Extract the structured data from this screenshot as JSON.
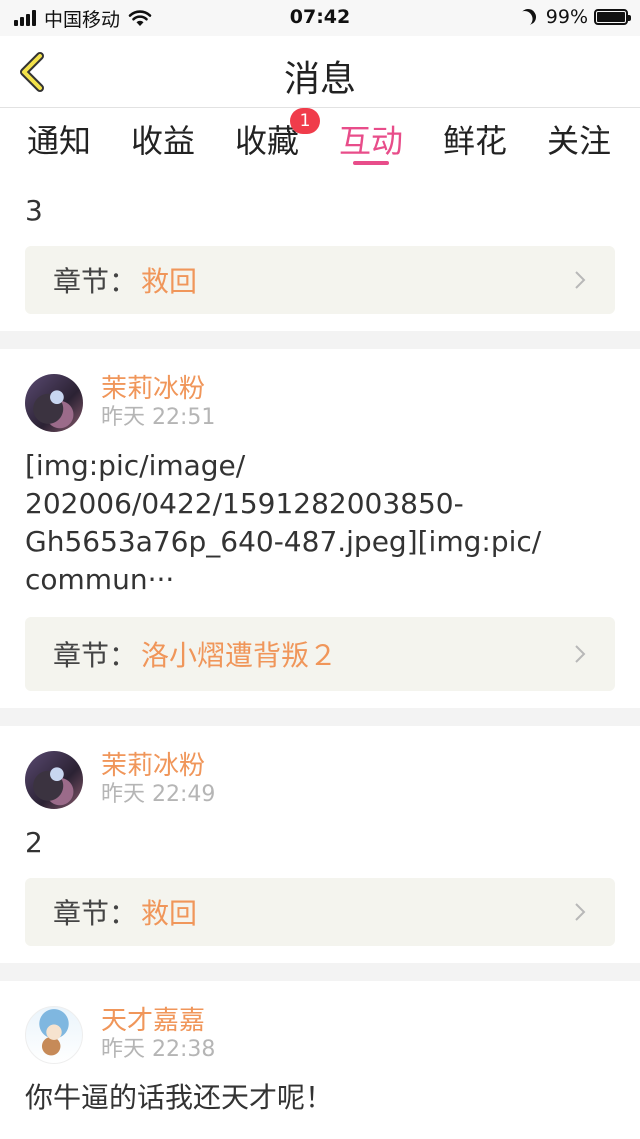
{
  "status_bar": {
    "carrier": "中国移动",
    "time": "07:42",
    "battery": "99%",
    "battery_level": 0.99,
    "icons": [
      "signal-icon",
      "wifi-icon",
      "moon-icon",
      "battery-icon"
    ]
  },
  "nav": {
    "title": "消息",
    "back_icon": "chevron-left-icon"
  },
  "tabs": [
    {
      "label": "通知",
      "active": false
    },
    {
      "label": "收益",
      "active": false
    },
    {
      "label": "收藏",
      "active": false,
      "badge": "1"
    },
    {
      "label": "互动",
      "active": true
    },
    {
      "label": "鲜花",
      "active": false
    },
    {
      "label": "关注",
      "active": false
    }
  ],
  "colors": {
    "accent": "#e84d8a",
    "name": "#f0965a",
    "badge": "#f03c4b",
    "chapter_bg": "#f4f4ee"
  },
  "feed": [
    {
      "text": "3",
      "chapter_prefix": "章节：",
      "chapter": "救回"
    },
    {
      "author": "茉莉冰粉",
      "time": "昨天 22:51",
      "text_lines": [
        "[img:pic/image/",
        "202006/0422/1591282003850-",
        "Gh5653a76p_640-487.jpeg][img:pic/",
        "commun···"
      ],
      "chapter_prefix": "章节：",
      "chapter": "洛小熠遭背叛２"
    },
    {
      "author": "茉莉冰粉",
      "time": "昨天 22:49",
      "text": "2",
      "chapter_prefix": "章节：",
      "chapter": "救回"
    },
    {
      "author": "天才嘉嘉",
      "time": "昨天 22:38",
      "text": "你牛逼的话我还天才呢！"
    }
  ]
}
